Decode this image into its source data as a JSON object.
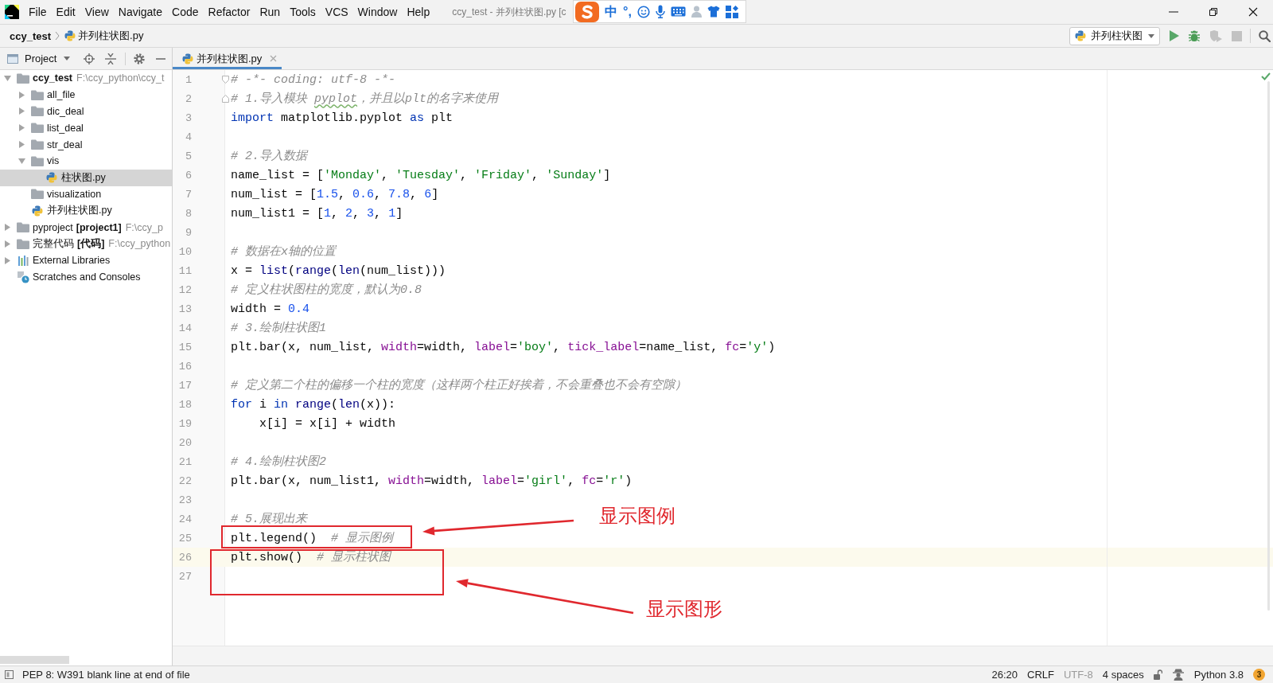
{
  "window": {
    "title": "ccy_test - 并列柱状图.py [c",
    "menu": [
      "File",
      "Edit",
      "View",
      "Navigate",
      "Code",
      "Refactor",
      "Run",
      "Tools",
      "VCS",
      "Window",
      "Help"
    ]
  },
  "ime_toolbar": {
    "mode": "中",
    "punctuation": "°,"
  },
  "breadcrumbs": [
    {
      "kind": "project",
      "text": "ccy_test"
    },
    {
      "kind": "python_file",
      "text": "并列柱状图.py"
    }
  ],
  "run_config": {
    "label": "并列柱状图"
  },
  "toolbar": [
    {
      "kind": "run",
      "disabled": false
    },
    {
      "kind": "debug",
      "disabled": false
    },
    {
      "kind": "coverage",
      "disabled": true
    },
    {
      "kind": "stop",
      "disabled": true
    },
    {
      "kind": "search",
      "disabled": false
    }
  ],
  "project_panel": {
    "title": "Project",
    "tree": [
      {
        "name": "ccy_test",
        "path": "F:\\ccy_python\\ccy_t",
        "kind": "project_root",
        "expanded": true,
        "selected": false,
        "children": [
          {
            "name": "all_file",
            "kind": "folder",
            "expanded": false,
            "selected": false
          },
          {
            "name": "dic_deal",
            "kind": "folder",
            "expanded": false,
            "selected": false
          },
          {
            "name": "list_deal",
            "kind": "folder",
            "expanded": false,
            "selected": false
          },
          {
            "name": "str_deal",
            "kind": "folder",
            "expanded": false,
            "selected": false
          },
          {
            "name": "vis",
            "kind": "folder",
            "expanded": true,
            "selected": false,
            "children": [
              {
                "name": "柱状图.py",
                "kind": "python_file",
                "selected": true
              }
            ]
          },
          {
            "name": "visualization",
            "kind": "folder",
            "selected": false
          },
          {
            "name": "并列柱状图.py",
            "kind": "python_file",
            "selected": false
          }
        ]
      },
      {
        "name": "pyproject",
        "tag": "[project1]",
        "path": "F:\\ccy_p",
        "kind": "folder",
        "expanded": false,
        "selected": false
      },
      {
        "name": "完整代码",
        "tag": "[代码]",
        "path": "F:\\ccy_python",
        "kind": "folder",
        "expanded": false,
        "selected": false
      },
      {
        "name": "External Libraries",
        "kind": "library",
        "expanded": false,
        "selected": false
      },
      {
        "name": "Scratches and Consoles",
        "kind": "scratches",
        "selected": false
      }
    ]
  },
  "tabs": [
    {
      "label": "并列柱状图.py",
      "selected": true
    }
  ],
  "editor": {
    "lines": [
      {
        "number": "1",
        "current": false,
        "fold_start": true,
        "tokens": [
          {
            "kind": "comment",
            "text": "# -*- coding: utf-8 -*-"
          }
        ]
      },
      {
        "number": "2",
        "current": false,
        "fold_end": true,
        "tokens": [
          {
            "kind": "comment",
            "text": "# 1.导入模块 "
          },
          {
            "kind": "comment_typo",
            "text": "pyplot"
          },
          {
            "kind": "comment",
            "text": "，并且以plt的名字来使用"
          }
        ]
      },
      {
        "number": "3",
        "current": false,
        "tokens": [
          {
            "kind": "keyword",
            "text": "import"
          },
          {
            "kind": "plain",
            "text": " matplotlib.pyplot "
          },
          {
            "kind": "keyword",
            "text": "as"
          },
          {
            "kind": "plain",
            "text": " plt"
          }
        ]
      },
      {
        "number": "4",
        "current": false
      },
      {
        "number": "5",
        "current": false,
        "tokens": [
          {
            "kind": "comment",
            "text": "# 2.导入数据"
          }
        ]
      },
      {
        "number": "6",
        "current": false,
        "tokens": [
          {
            "kind": "plain",
            "text": "name_list = ["
          },
          {
            "kind": "string",
            "text": "'Monday'"
          },
          {
            "kind": "plain",
            "text": ", "
          },
          {
            "kind": "string",
            "text": "'Tuesday'"
          },
          {
            "kind": "plain",
            "text": ", "
          },
          {
            "kind": "string",
            "text": "'Friday'"
          },
          {
            "kind": "plain",
            "text": ", "
          },
          {
            "kind": "string",
            "text": "'Sunday'"
          },
          {
            "kind": "plain",
            "text": "]"
          }
        ]
      },
      {
        "number": "7",
        "current": false,
        "tokens": [
          {
            "kind": "plain",
            "text": "num_list = ["
          },
          {
            "kind": "number",
            "text": "1.5"
          },
          {
            "kind": "plain",
            "text": ", "
          },
          {
            "kind": "number",
            "text": "0.6"
          },
          {
            "kind": "plain",
            "text": ", "
          },
          {
            "kind": "number",
            "text": "7.8"
          },
          {
            "kind": "plain",
            "text": ", "
          },
          {
            "kind": "number",
            "text": "6"
          },
          {
            "kind": "plain",
            "text": "]"
          }
        ]
      },
      {
        "number": "8",
        "current": false,
        "tokens": [
          {
            "kind": "plain",
            "text": "num_list1 = ["
          },
          {
            "kind": "number",
            "text": "1"
          },
          {
            "kind": "plain",
            "text": ", "
          },
          {
            "kind": "number",
            "text": "2"
          },
          {
            "kind": "plain",
            "text": ", "
          },
          {
            "kind": "number",
            "text": "3"
          },
          {
            "kind": "plain",
            "text": ", "
          },
          {
            "kind": "number",
            "text": "1"
          },
          {
            "kind": "plain",
            "text": "]"
          }
        ]
      },
      {
        "number": "9",
        "current": false
      },
      {
        "number": "10",
        "current": false,
        "tokens": [
          {
            "kind": "comment",
            "text": "# 数据在x轴的位置"
          }
        ]
      },
      {
        "number": "11",
        "current": false,
        "tokens": [
          {
            "kind": "plain",
            "text": "x = "
          },
          {
            "kind": "builtin",
            "text": "list"
          },
          {
            "kind": "plain",
            "text": "("
          },
          {
            "kind": "builtin",
            "text": "range"
          },
          {
            "kind": "plain",
            "text": "("
          },
          {
            "kind": "builtin",
            "text": "len"
          },
          {
            "kind": "plain",
            "text": "(num_list)))"
          }
        ]
      },
      {
        "number": "12",
        "current": false,
        "tokens": [
          {
            "kind": "comment",
            "text": "# 定义柱状图柱的宽度，默认为0.8"
          }
        ]
      },
      {
        "number": "13",
        "current": false,
        "tokens": [
          {
            "kind": "plain",
            "text": "width = "
          },
          {
            "kind": "number",
            "text": "0.4"
          }
        ]
      },
      {
        "number": "14",
        "current": false,
        "tokens": [
          {
            "kind": "comment",
            "text": "# 3.绘制柱状图1"
          }
        ]
      },
      {
        "number": "15",
        "current": false,
        "tokens": [
          {
            "kind": "plain",
            "text": "plt.bar(x, num_list, "
          },
          {
            "kind": "kwarg",
            "text": "width"
          },
          {
            "kind": "plain",
            "text": "=width, "
          },
          {
            "kind": "kwarg",
            "text": "label"
          },
          {
            "kind": "plain",
            "text": "="
          },
          {
            "kind": "string",
            "text": "'boy'"
          },
          {
            "kind": "plain",
            "text": ", "
          },
          {
            "kind": "kwarg",
            "text": "tick_label"
          },
          {
            "kind": "plain",
            "text": "=name_list, "
          },
          {
            "kind": "kwarg",
            "text": "fc"
          },
          {
            "kind": "plain",
            "text": "="
          },
          {
            "kind": "string",
            "text": "'y'"
          },
          {
            "kind": "plain",
            "text": ")"
          }
        ]
      },
      {
        "number": "16",
        "current": false
      },
      {
        "number": "17",
        "current": false,
        "tokens": [
          {
            "kind": "comment",
            "text": "# 定义第二个柱的偏移一个柱的宽度（这样两个柱正好挨着，不会重叠也不会有空隙）"
          }
        ]
      },
      {
        "number": "18",
        "current": false,
        "tokens": [
          {
            "kind": "keyword",
            "text": "for"
          },
          {
            "kind": "plain",
            "text": " i "
          },
          {
            "kind": "keyword",
            "text": "in "
          },
          {
            "kind": "builtin",
            "text": "range"
          },
          {
            "kind": "plain",
            "text": "("
          },
          {
            "kind": "builtin",
            "text": "len"
          },
          {
            "kind": "plain",
            "text": "(x)):"
          }
        ]
      },
      {
        "number": "19",
        "current": false,
        "tokens": [
          {
            "kind": "plain",
            "text": "    x[i] = x[i] + width"
          }
        ]
      },
      {
        "number": "20",
        "current": false
      },
      {
        "number": "21",
        "current": false,
        "tokens": [
          {
            "kind": "comment",
            "text": "# 4.绘制柱状图2"
          }
        ]
      },
      {
        "number": "22",
        "current": false,
        "tokens": [
          {
            "kind": "plain",
            "text": "plt.bar(x, num_list1, "
          },
          {
            "kind": "kwarg",
            "text": "width"
          },
          {
            "kind": "plain",
            "text": "=width, "
          },
          {
            "kind": "kwarg",
            "text": "label"
          },
          {
            "kind": "plain",
            "text": "="
          },
          {
            "kind": "string",
            "text": "'girl'"
          },
          {
            "kind": "plain",
            "text": ", "
          },
          {
            "kind": "kwarg",
            "text": "fc"
          },
          {
            "kind": "plain",
            "text": "="
          },
          {
            "kind": "string",
            "text": "'r'"
          },
          {
            "kind": "plain",
            "text": ")"
          }
        ]
      },
      {
        "number": "23",
        "current": false
      },
      {
        "number": "24",
        "current": false,
        "tokens": [
          {
            "kind": "comment",
            "text": "# 5.展现出来"
          }
        ]
      },
      {
        "number": "25",
        "current": false,
        "tokens": [
          {
            "kind": "plain",
            "text": "plt.legend()  "
          },
          {
            "kind": "comment",
            "text": "# 显示图例"
          }
        ]
      },
      {
        "number": "26",
        "current": true,
        "tokens": [
          {
            "kind": "plain",
            "text": "plt.show()  "
          },
          {
            "kind": "comment",
            "text": "# 显示柱状图"
          }
        ]
      },
      {
        "number": "27",
        "current": false
      }
    ]
  },
  "annotations": [
    {
      "label": "显示图例"
    },
    {
      "label": "显示图形"
    }
  ],
  "status_bar": {
    "message": "PEP 8: W391 blank line at end of file",
    "widgets": [
      {
        "text": "26:20",
        "disabled": false
      },
      {
        "text": "CRLF",
        "disabled": false
      },
      {
        "text": "UTF-8",
        "disabled": true
      },
      {
        "text": "4 spaces",
        "disabled": false
      }
    ],
    "interpreter": "Python 3.8",
    "notifications": "3"
  }
}
